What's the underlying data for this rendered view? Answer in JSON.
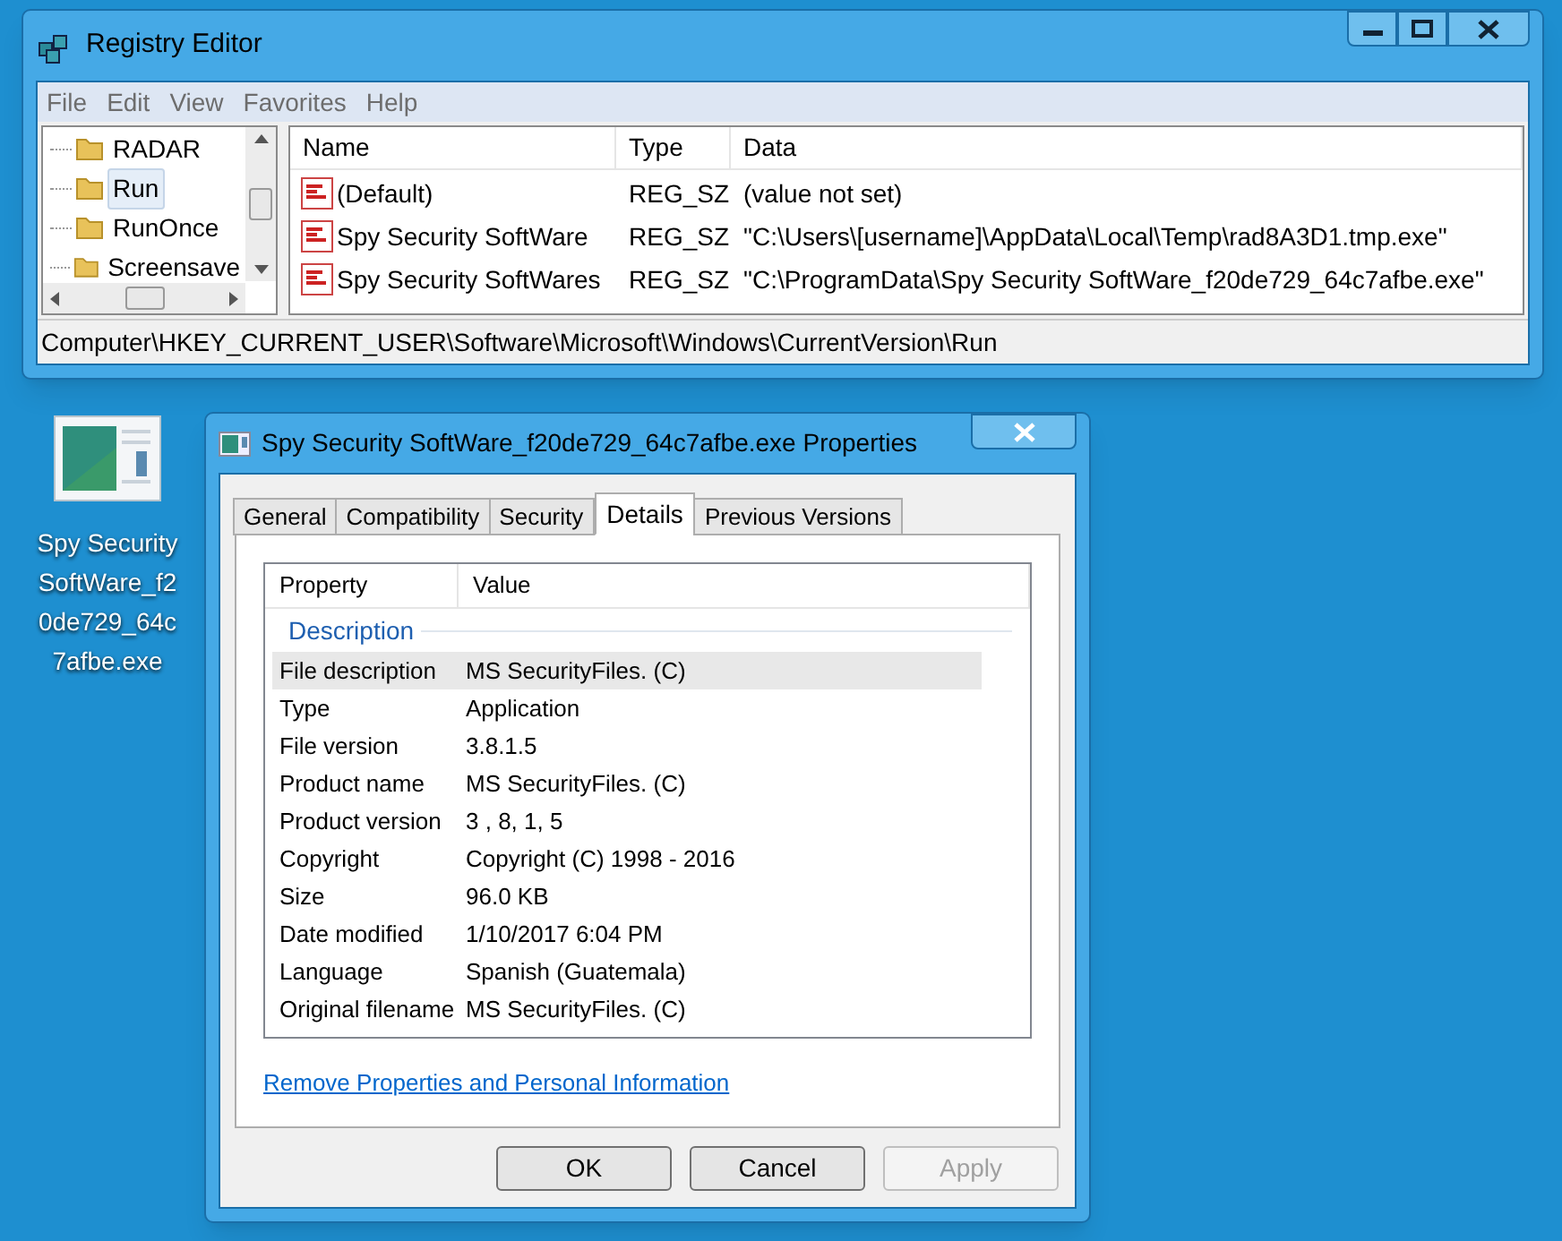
{
  "registry_window": {
    "title": "Registry Editor",
    "menu": [
      "File",
      "Edit",
      "View",
      "Favorites",
      "Help"
    ],
    "tree": [
      {
        "label": "RADAR",
        "selected": false
      },
      {
        "label": "Run",
        "selected": true
      },
      {
        "label": "RunOnce",
        "selected": false
      },
      {
        "label": "Screensave",
        "selected": false
      }
    ],
    "columns": [
      "Name",
      "Type",
      "Data"
    ],
    "rows": [
      {
        "name": "(Default)",
        "type": "REG_SZ",
        "data": "(value not set)"
      },
      {
        "name": "Spy Security SoftWare",
        "type": "REG_SZ",
        "data": "\"C:\\Users\\[username]\\AppData\\Local\\Temp\\rad8A3D1.tmp.exe\""
      },
      {
        "name": "Spy Security SoftWares",
        "type": "REG_SZ",
        "data": "\"C:\\ProgramData\\Spy Security SoftWare_f20de729_64c7afbe.exe\""
      }
    ],
    "status_bar": "Computer\\HKEY_CURRENT_USER\\Software\\Microsoft\\Windows\\CurrentVersion\\Run"
  },
  "desktop_icon": {
    "label": "Spy Security SoftWare_f20de729_64c7afbe.exe"
  },
  "properties_window": {
    "title": "Spy Security SoftWare_f20de729_64c7afbe.exe Properties",
    "tabs": [
      {
        "label": "General",
        "selected": false
      },
      {
        "label": "Compatibility",
        "selected": false
      },
      {
        "label": "Security",
        "selected": false
      },
      {
        "label": "Details",
        "selected": true
      },
      {
        "label": "Previous Versions",
        "selected": false
      }
    ],
    "columns": [
      "Property",
      "Value"
    ],
    "group": "Description",
    "properties": [
      {
        "property": "File description",
        "value": "MS SecurityFiles. (C)",
        "selected": true
      },
      {
        "property": "Type",
        "value": "Application",
        "selected": false
      },
      {
        "property": "File version",
        "value": "3.8.1.5",
        "selected": false
      },
      {
        "property": "Product name",
        "value": "MS SecurityFiles. (C)",
        "selected": false
      },
      {
        "property": "Product version",
        "value": "3 , 8, 1, 5",
        "selected": false
      },
      {
        "property": "Copyright",
        "value": "Copyright (C) 1998 - 2016",
        "selected": false
      },
      {
        "property": "Size",
        "value": "96.0 KB",
        "selected": false
      },
      {
        "property": "Date modified",
        "value": "1/10/2017 6:04 PM",
        "selected": false
      },
      {
        "property": "Language",
        "value": "Spanish (Guatemala)",
        "selected": false
      },
      {
        "property": "Original filename",
        "value": "MS SecurityFiles. (C)",
        "selected": false
      }
    ],
    "link": "Remove Properties and Personal Information",
    "buttons": [
      {
        "label": "OK",
        "disabled": false
      },
      {
        "label": "Cancel",
        "disabled": false
      },
      {
        "label": "Apply",
        "disabled": true
      }
    ]
  }
}
